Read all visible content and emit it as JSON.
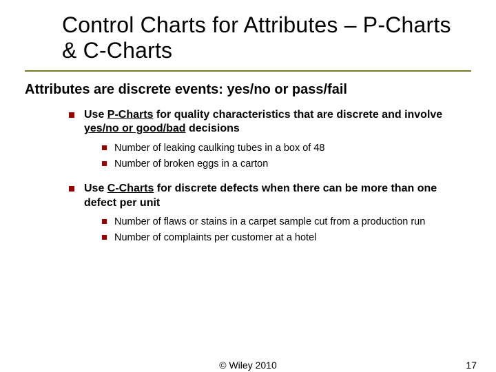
{
  "title": "Control Charts for Attributes – P-Charts & C-Charts",
  "lead": "Attributes are discrete events: yes/no or pass/fail",
  "bullets": [
    {
      "pre": "Use ",
      "term": "P-Charts",
      "mid": " for quality characteristics that are discrete and involve ",
      "term2": "yes/no or good/bad",
      "post": " decisions",
      "sub": [
        "Number of leaking caulking tubes in a box of 48",
        "Number of broken eggs in a carton"
      ]
    },
    {
      "pre": "Use ",
      "term": "C-Charts",
      "mid": " for discrete defects when there can be more than one defect per unit",
      "term2": "",
      "post": "",
      "sub": [
        "Number of flaws or stains in a carpet sample cut from a production run",
        "Number of complaints per customer at a hotel"
      ]
    }
  ],
  "copyright": "© Wiley 2010",
  "page": "17"
}
